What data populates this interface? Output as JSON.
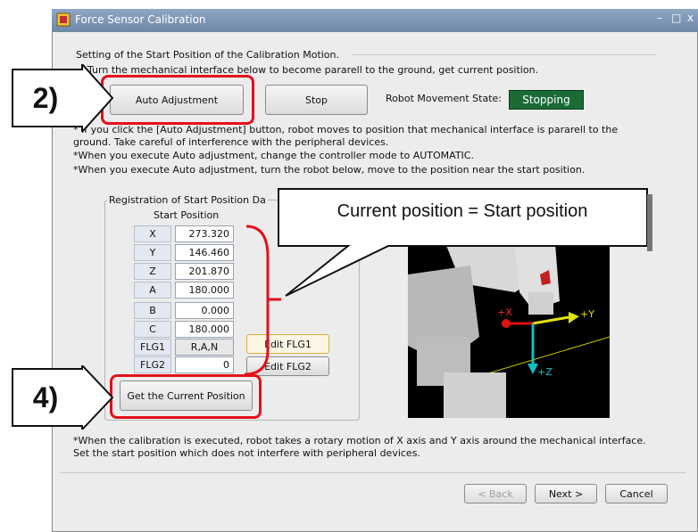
{
  "window": {
    "title": "Force Sensor Calibration",
    "controls": [
      "–",
      "□",
      "x"
    ]
  },
  "section1": {
    "title": "Setting of the Start Position of the Calibration Motion.",
    "line1": "Turn the mechanical interface below to become pararell to the ground, get current position.",
    "auto_button": "Auto Adjustment",
    "stop_button": "Stop",
    "state_label": "Robot Movement State:",
    "state_value": "Stopping",
    "note1a": "* If you click the [Auto Adjustment] button, robot moves to position that mechanical interface is pararell to the",
    "note1b": "ground. Take careful of  interference with the peripheral devices.",
    "note2": "*When you execute Auto adjustment, change the controller mode to AUTOMATIC.",
    "note3": "*When you execute Auto adjustment, turn the robot below, move to the position near the start position."
  },
  "registration": {
    "group_title": "Registration of Start Position Da",
    "subtitle": "Start Position",
    "rows": [
      {
        "label": "X",
        "value": "273.320"
      },
      {
        "label": "Y",
        "value": "146.460"
      },
      {
        "label": "Z",
        "value": "201.870"
      },
      {
        "label": "A",
        "value": "180.000"
      },
      {
        "label": "B",
        "value": "0.000"
      },
      {
        "label": "C",
        "value": "180.000"
      },
      {
        "label": "FLG1",
        "value": "R,A,N"
      },
      {
        "label": "FLG2",
        "value": "0"
      }
    ],
    "edit_flg1": "Edit FLG1",
    "edit_flg2": "Edit FLG2",
    "get_current": "Get the Current Position"
  },
  "robot_view": {
    "axis_x": "+X",
    "axis_y": "+Y",
    "axis_z": "+Z"
  },
  "bottom": {
    "note_a": "*When the calibration is executed, robot takes a rotary motion of X axis and Y axis around the mechanical interface.",
    "note_b": "Set the start position which does not interfere with peripheral devices.",
    "back": "< Back",
    "next": "Next >",
    "cancel": "Cancel"
  },
  "annotations": {
    "step2": "2)",
    "step4": "4)",
    "callout": "Current position = Start position"
  }
}
